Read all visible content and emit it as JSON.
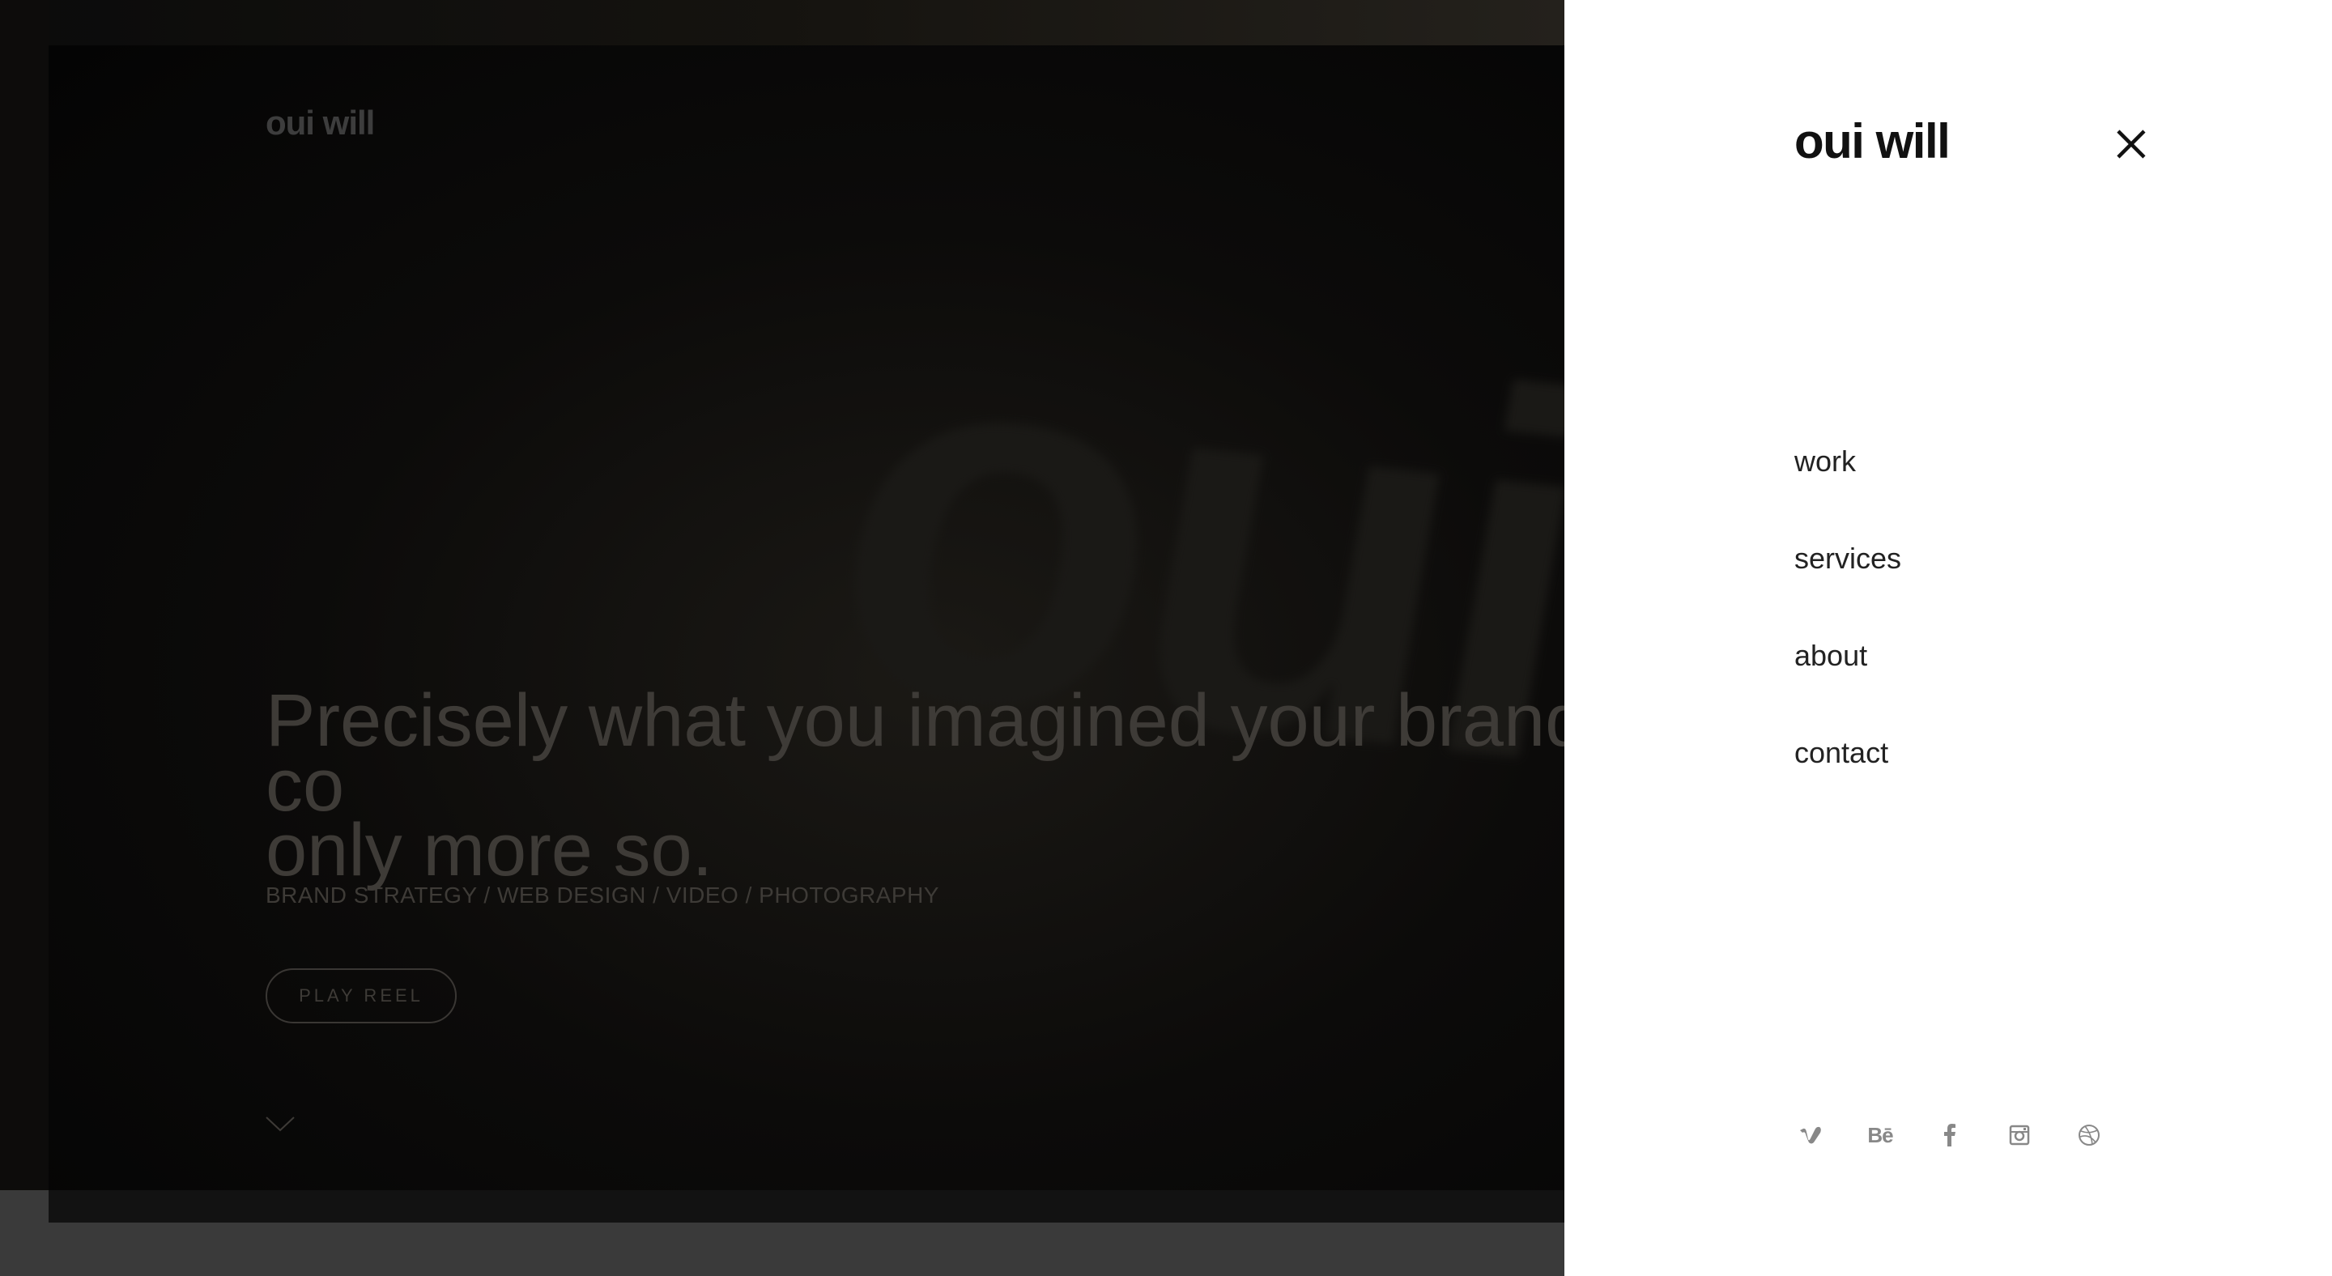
{
  "brand": {
    "name": "oui will"
  },
  "hero": {
    "headline": "Precisely what you imagined your brand co\nonly more so.",
    "services": "BRAND STRATEGY / WEB DESIGN / VIDEO / PHOTOGRAPHY",
    "play_reel_label": "PLAY REEL",
    "background_logo_text": "oui w"
  },
  "menu": {
    "items": [
      {
        "label": "work"
      },
      {
        "label": "services"
      },
      {
        "label": "about"
      },
      {
        "label": "contact"
      }
    ],
    "close_icon": "close-icon",
    "social": [
      {
        "icon": "vimeo-icon"
      },
      {
        "icon": "behance-icon",
        "text": "Bē"
      },
      {
        "icon": "facebook-icon"
      },
      {
        "icon": "instagram-icon"
      },
      {
        "icon": "dribbble-icon"
      }
    ]
  },
  "colors": {
    "panel_background": "#ffffff",
    "panel_text": "#222222",
    "social_icon": "#888888",
    "overlay_text": "#3e3b37"
  }
}
